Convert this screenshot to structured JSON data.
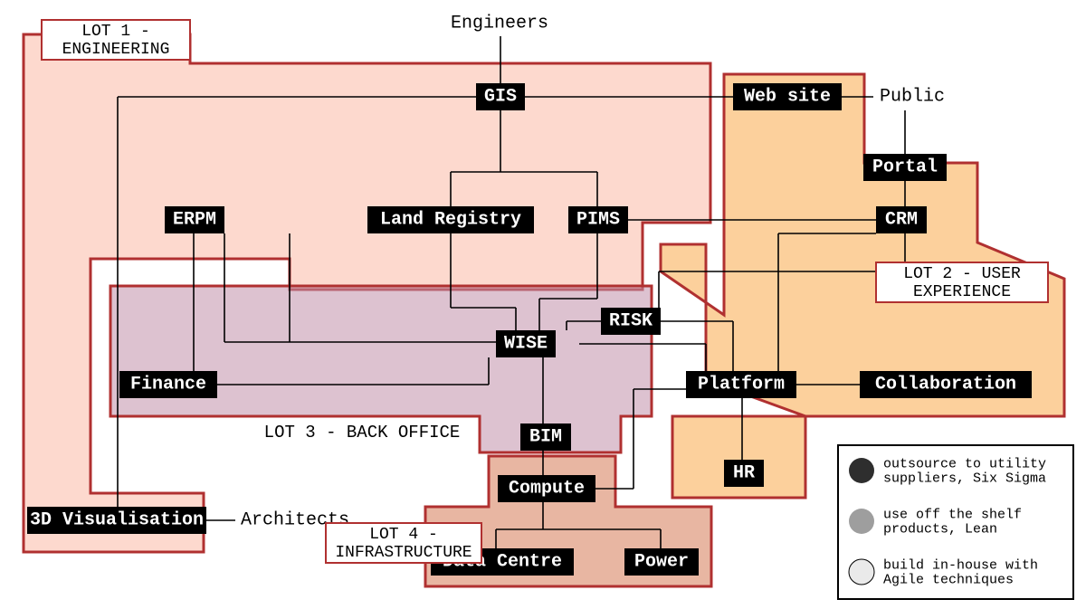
{
  "nodes": {
    "gis": {
      "label": "GIS"
    },
    "website": {
      "label": "Web site"
    },
    "portal": {
      "label": "Portal"
    },
    "erpm": {
      "label": "ERPM"
    },
    "landreg": {
      "label": "Land Registry"
    },
    "pims": {
      "label": "PIMS"
    },
    "crm": {
      "label": "CRM"
    },
    "risk": {
      "label": "RISK"
    },
    "wise": {
      "label": "WISE"
    },
    "finance": {
      "label": "Finance"
    },
    "platform": {
      "label": "Platform"
    },
    "collab": {
      "label": "Collaboration"
    },
    "bim": {
      "label": "BIM"
    },
    "compute": {
      "label": "Compute"
    },
    "hr": {
      "label": "HR"
    },
    "viz3d": {
      "label": "3D Visualisation"
    },
    "datacentre": {
      "label": "Data Centre"
    },
    "power": {
      "label": "Power"
    }
  },
  "actors": {
    "engineers": {
      "label": "Engineers"
    },
    "public": {
      "label": "Public"
    },
    "architects": {
      "label": "Architects"
    }
  },
  "lots": {
    "lot1": {
      "label_l1": "LOT 1 -",
      "label_l2": "ENGINEERING"
    },
    "lot2": {
      "label_l1": "LOT 2 - USER",
      "label_l2": "EXPERIENCE"
    },
    "lot3": {
      "label": "LOT 3 - BACK OFFICE"
    },
    "lot4": {
      "label_l1": "LOT 4 -",
      "label_l2": "INFRASTRUCTURE"
    }
  },
  "legend": {
    "dark": {
      "line1": "outsource to utility",
      "line2": "suppliers, Six Sigma"
    },
    "mid": {
      "line1": "use off the shelf",
      "line2": "products, Lean"
    },
    "light": {
      "line1": "build in-house with",
      "line2": "Agile techniques"
    }
  }
}
